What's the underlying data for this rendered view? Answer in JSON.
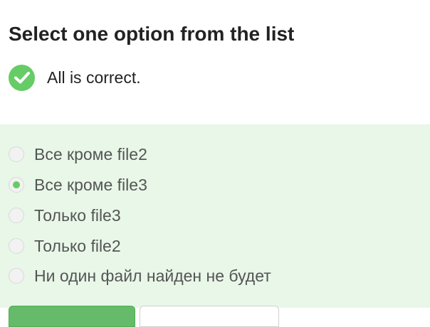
{
  "header": {
    "title": "Select one option from the list"
  },
  "status": {
    "text": "All is correct.",
    "icon": "check-circle-icon",
    "color": "#66cc66"
  },
  "options": [
    {
      "label": "Все кроме file2",
      "selected": false
    },
    {
      "label": "Все кроме file3",
      "selected": true
    },
    {
      "label": "Только file3",
      "selected": false
    },
    {
      "label": "Только file2",
      "selected": false
    },
    {
      "label": "Ни один файл найден не будет",
      "selected": false
    }
  ],
  "colors": {
    "accent": "#66cc66",
    "panel_background": "#e8f7e8"
  }
}
